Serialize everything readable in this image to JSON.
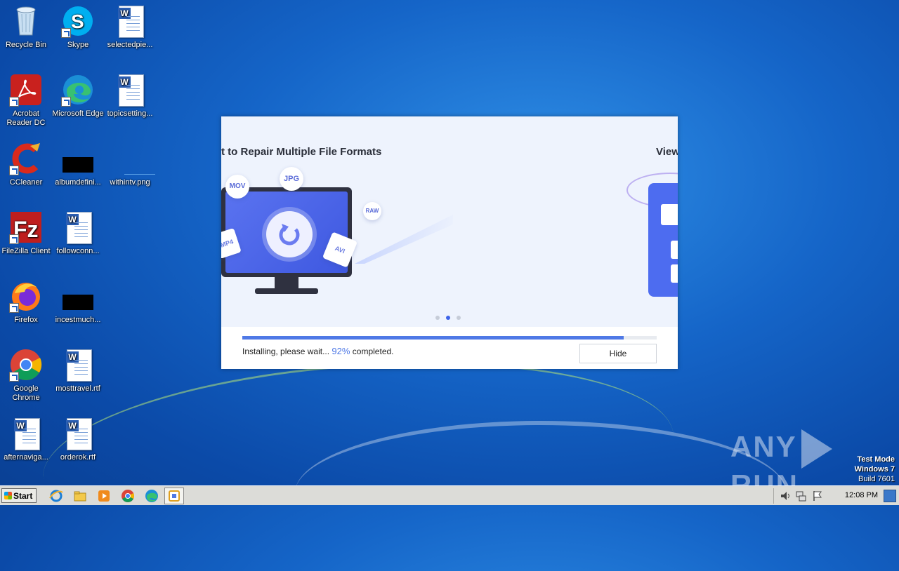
{
  "desktop": {
    "icons": [
      {
        "label": "Recycle Bin",
        "icon": "recycle-bin-icon"
      },
      {
        "label": "Skype",
        "icon": "skype-icon"
      },
      {
        "label": "selectedpie...",
        "icon": "word-document-icon"
      },
      {
        "label": "Acrobat Reader DC",
        "icon": "acrobat-icon"
      },
      {
        "label": "Microsoft Edge",
        "icon": "edge-icon"
      },
      {
        "label": "topicsetting...",
        "icon": "word-document-icon"
      },
      {
        "label": "CCleaner",
        "icon": "ccleaner-icon"
      },
      {
        "label": "albumdefini...",
        "icon": "image-file-icon"
      },
      {
        "label": "withintv.png",
        "icon": "image-file-icon"
      },
      {
        "label": "FileZilla Client",
        "icon": "filezilla-icon"
      },
      {
        "label": "followconn...",
        "icon": "word-document-icon"
      },
      {
        "label": "Firefox",
        "icon": "firefox-icon"
      },
      {
        "label": "incestmuch...",
        "icon": "image-file-icon"
      },
      {
        "label": "Google Chrome",
        "icon": "chrome-icon"
      },
      {
        "label": "mosttravel.rtf",
        "icon": "word-document-icon"
      },
      {
        "label": "afternaviga...",
        "icon": "word-document-icon"
      },
      {
        "label": "orderok.rtf",
        "icon": "word-document-icon"
      }
    ]
  },
  "installer": {
    "slide_title_current": "t to Repair Multiple File Formats",
    "slide_title_next": "View",
    "bubbles": {
      "mov": "MOV",
      "jpg": "JPG",
      "raw": "RAW",
      "avi": "AVI",
      "mp4": "MP4"
    },
    "carousel": {
      "count": 3,
      "active": 1
    },
    "progress": {
      "fraction": 0.92
    },
    "status_prefix": "Installing, please wait...",
    "status_percent": "92%",
    "status_suffix": "completed.",
    "hide_label": "Hide"
  },
  "watermark": {
    "left": "ANY",
    "right": "RUN"
  },
  "os_info": {
    "line1": "Test Mode",
    "line2": "Windows 7",
    "line3": "Build 7601"
  },
  "taskbar": {
    "start_label": "Start",
    "pinned": [
      "internet-explorer-icon",
      "file-explorer-icon",
      "media-player-icon",
      "chrome-icon",
      "edge-icon",
      "installer-app-icon"
    ],
    "clock": "12:08 PM"
  }
}
